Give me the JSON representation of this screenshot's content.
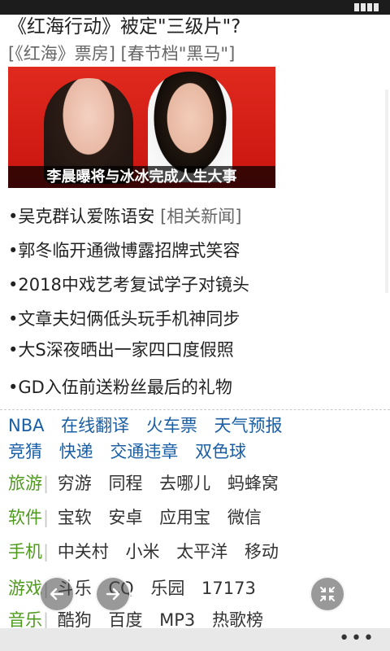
{
  "headline": "《红海行动》被定\"三级片\"?",
  "sublinks": "[《红海》票房] [春节档\"黑马\"]",
  "photo": {
    "caption": "李晨曝将与冰冰完成人生大事"
  },
  "news": [
    {
      "text": "•吴克群认爱陈语安",
      "related": "[相关新闻]"
    },
    {
      "text": "•郭冬临开通微博露招牌式笑容"
    },
    {
      "text": "•2018中戏艺考复试学子对镜头"
    },
    {
      "text": "•文章夫妇俩低头玩手机神同步"
    },
    {
      "text": "•大S深夜晒出一家四口度假照"
    },
    {
      "text": "•GD入伍前送粉丝最后的礼物"
    }
  ],
  "quick_links_row1": [
    "NBA",
    "在线翻译",
    "火车票",
    "天气预报"
  ],
  "quick_links_row2": [
    "竞猜",
    "快递",
    "交通违章",
    "双色球"
  ],
  "categories": [
    {
      "name": "旅游",
      "items": [
        "穷游",
        "同程",
        "去哪儿",
        "蚂蜂窝"
      ]
    },
    {
      "name": "软件",
      "items": [
        "宝软",
        "安卓",
        "应用宝",
        "微信"
      ]
    },
    {
      "name": "手机",
      "items": [
        "中关村",
        "小米",
        "太平洋",
        "移动"
      ]
    },
    {
      "name": "游戏",
      "items": [
        "斗乐",
        "CQ",
        "乐园",
        "17173"
      ]
    },
    {
      "name": "音乐",
      "items": [
        "酷狗",
        "百度",
        "MP3",
        "热歌榜"
      ]
    }
  ],
  "icons": {
    "back": "arrow-left-icon",
    "forward": "arrow-right-icon",
    "exit_fullscreen": "collapse-icon",
    "menu": "more-dots-icon"
  },
  "bottombar": {
    "menu_label": "•••"
  }
}
